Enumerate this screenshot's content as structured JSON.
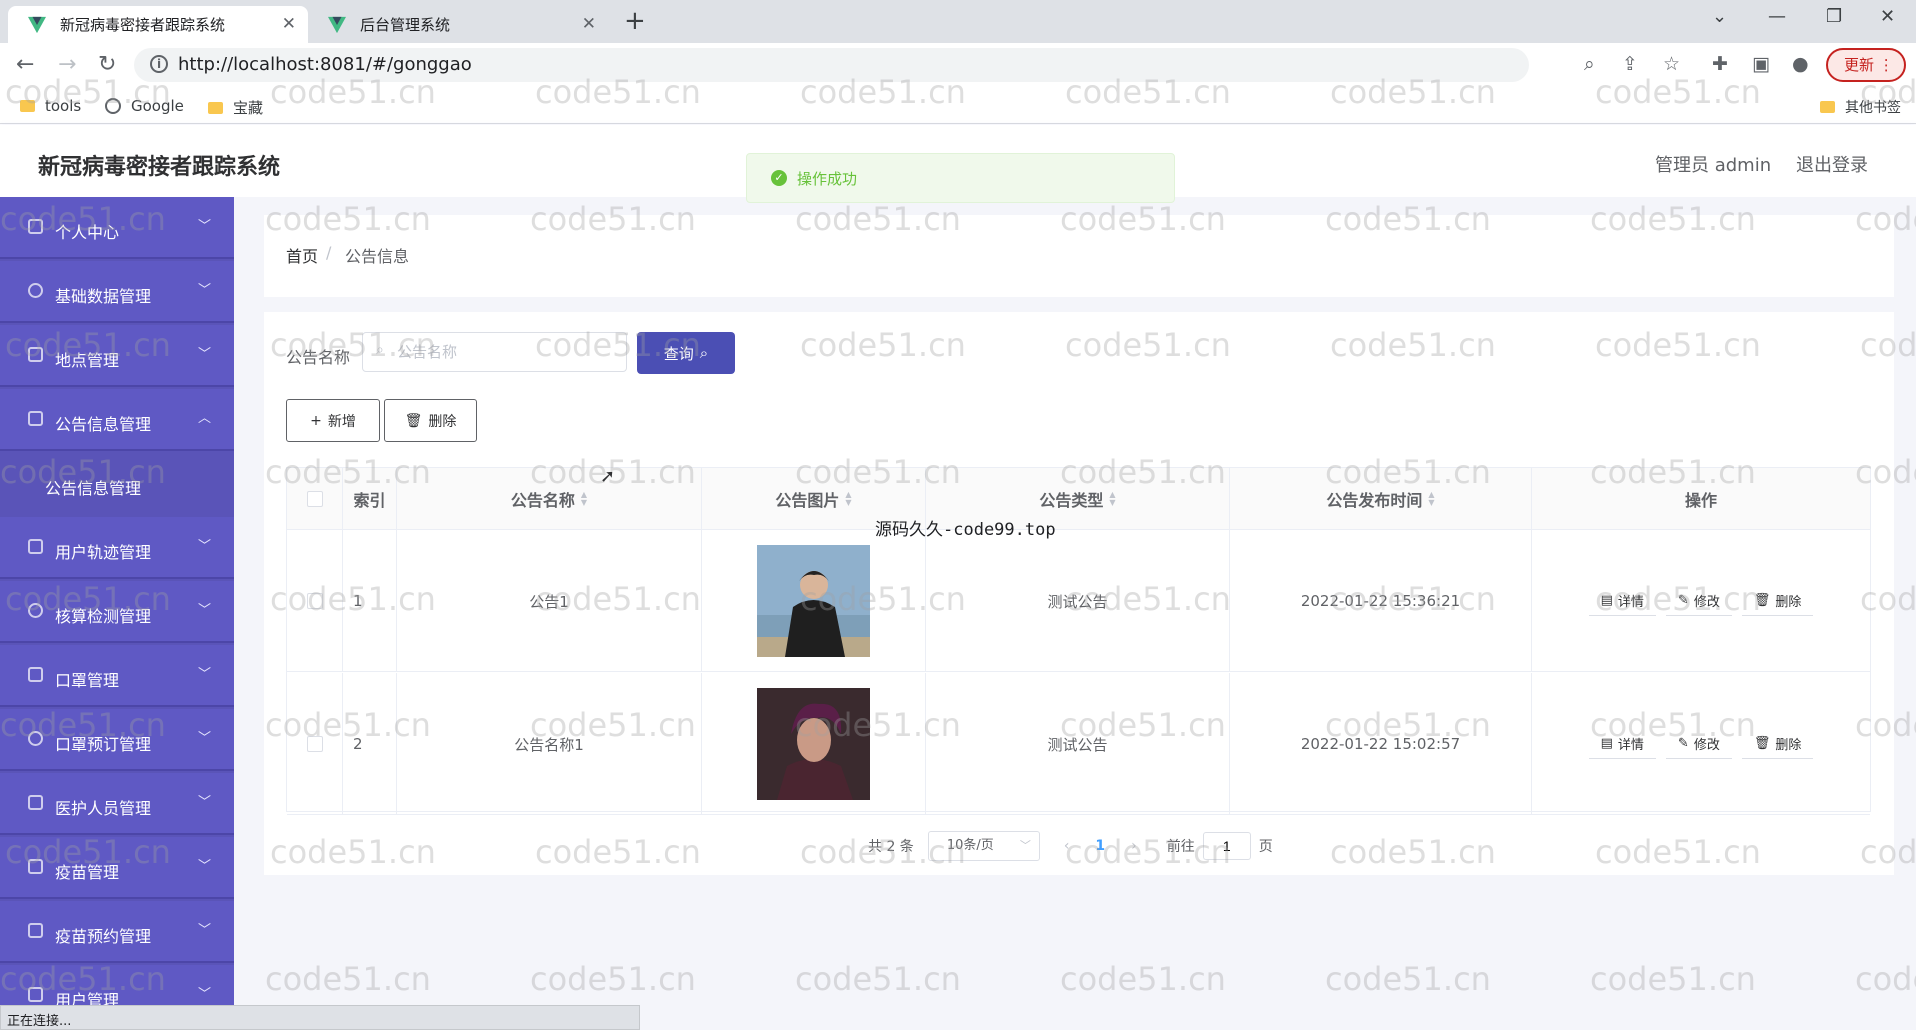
{
  "browser": {
    "tabs": [
      {
        "title": "新冠病毒密接者跟踪系统",
        "active": true
      },
      {
        "title": "后台管理系统",
        "active": false
      }
    ],
    "url": "http://localhost:8081/#/gonggao",
    "update_label": "更新",
    "bookmarks": [
      "tools",
      "Google",
      "宝藏"
    ],
    "other_bookmarks": "其他书签",
    "status_text": "正在连接..."
  },
  "header": {
    "title": "新冠病毒密接者跟踪系统",
    "admin_label": "管理员 admin",
    "logout_label": "退出登录"
  },
  "toast": {
    "text": "操作成功",
    "type": "success",
    "color": "#67c23a"
  },
  "sidebar": {
    "bg_color": "#5f59c4",
    "items": [
      {
        "label": "个人中心",
        "expanded": false,
        "icon": "user-icon"
      },
      {
        "label": "基础数据管理",
        "expanded": false,
        "icon": "clock-icon"
      },
      {
        "label": "地点管理",
        "expanded": false,
        "icon": "card-icon"
      },
      {
        "label": "公告信息管理",
        "expanded": true,
        "icon": "message-icon",
        "children": [
          "公告信息管理"
        ]
      },
      {
        "label": "用户轨迹管理",
        "expanded": false,
        "icon": "list-icon"
      },
      {
        "label": "核算检测管理",
        "expanded": false,
        "icon": "aperture-icon"
      },
      {
        "label": "口罩管理",
        "expanded": false,
        "icon": "bag-icon"
      },
      {
        "label": "口罩预订管理",
        "expanded": false,
        "icon": "compass-icon"
      },
      {
        "label": "医护人员管理",
        "expanded": false,
        "icon": "chat-icon"
      },
      {
        "label": "疫苗管理",
        "expanded": false,
        "icon": "grid-icon"
      },
      {
        "label": "疫苗预约管理",
        "expanded": false,
        "icon": "box-icon"
      },
      {
        "label": "用户管理",
        "expanded": false,
        "icon": "user-group-icon"
      }
    ]
  },
  "breadcrumb": {
    "home": "首页",
    "separator": "/",
    "current": "公告信息"
  },
  "search": {
    "label": "公告名称",
    "placeholder": "公告名称",
    "value": "",
    "button_label": "查询"
  },
  "actions": {
    "add_label": "新增",
    "delete_label": "删除"
  },
  "table": {
    "columns": [
      "索引",
      "公告名称",
      "公告图片",
      "公告类型",
      "公告发布时间",
      "操作"
    ],
    "rows": [
      {
        "index": "1",
        "name": "公告1",
        "image": "person-photo-1",
        "type": "测试公告",
        "time": "2022-01-22 15:36:21"
      },
      {
        "index": "2",
        "name": "公告名称1",
        "image": "person-photo-2",
        "type": "测试公告",
        "time": "2022-01-22 15:02:57"
      }
    ],
    "row_actions": {
      "detail": "详情",
      "edit": "修改",
      "delete": "删除"
    }
  },
  "pagination": {
    "total_text": "共 2 条",
    "page_size": "10条/页",
    "current_page": "1",
    "goto_label": "前往",
    "goto_value": "1",
    "page_suffix": "页"
  },
  "watermark": {
    "site": "code51.cn",
    "overlay": "源码久久-code99.top"
  }
}
